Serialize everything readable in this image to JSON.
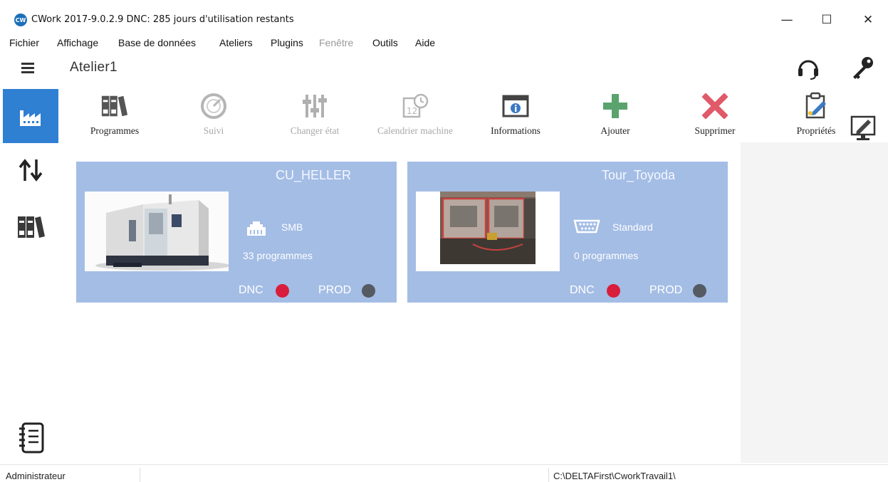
{
  "window": {
    "title": "CWork 2017-9.0.2.9  DNC: 285 jours d'utilisation restants",
    "logo_text": "CW",
    "minimize": "—",
    "maximize": "☐",
    "close": "✕"
  },
  "menu": {
    "items": [
      {
        "label": "Fichier",
        "enabled": true
      },
      {
        "label": "Affichage",
        "enabled": true
      },
      {
        "label": "Base de données",
        "enabled": true
      },
      {
        "label": "Ateliers",
        "enabled": true
      },
      {
        "label": "Plugins",
        "enabled": true
      },
      {
        "label": "Fenêtre",
        "enabled": false
      },
      {
        "label": "Outils",
        "enabled": true
      },
      {
        "label": "Aide",
        "enabled": true
      }
    ]
  },
  "header": {
    "workshop_title": "Atelier1"
  },
  "toolbar": {
    "items": [
      {
        "label": "Programmes",
        "enabled": true,
        "icon": "binders-icon"
      },
      {
        "label": "Suivi",
        "enabled": false,
        "icon": "gauge-icon"
      },
      {
        "label": "Changer état",
        "enabled": false,
        "icon": "sliders-icon"
      },
      {
        "label": "Calendrier machine",
        "enabled": false,
        "icon": "calendar-clock-icon"
      },
      {
        "label": "Informations",
        "enabled": true,
        "icon": "info-window-icon"
      },
      {
        "label": "Ajouter",
        "enabled": true,
        "icon": "plus-icon"
      },
      {
        "label": "Supprimer",
        "enabled": true,
        "icon": "delete-icon"
      },
      {
        "label": "Propriétés",
        "enabled": true,
        "icon": "clipboard-edit-icon"
      }
    ]
  },
  "machines": [
    {
      "name": "CU_HELLER",
      "connection": "SMB",
      "connection_icon": "network-icon",
      "programs": "33 programmes",
      "dnc_label": "DNC",
      "dnc_color": "#d81e3c",
      "prod_label": "PROD",
      "prod_color": "#555a63"
    },
    {
      "name": "Tour_Toyoda",
      "connection": "Standard",
      "connection_icon": "serial-port-icon",
      "programs": "0 programmes",
      "dnc_label": "DNC",
      "dnc_color": "#d81e3c",
      "prod_label": "PROD",
      "prod_color": "#555a63"
    }
  ],
  "status": {
    "user": "Administrateur",
    "path": "C:\\DELTAFirst\\CworkTravail1\\"
  },
  "colors": {
    "accent": "#2f7fd2",
    "card_bg": "#a4bde5",
    "add_green": "#5aa36e",
    "delete_red": "#e05a6a"
  }
}
